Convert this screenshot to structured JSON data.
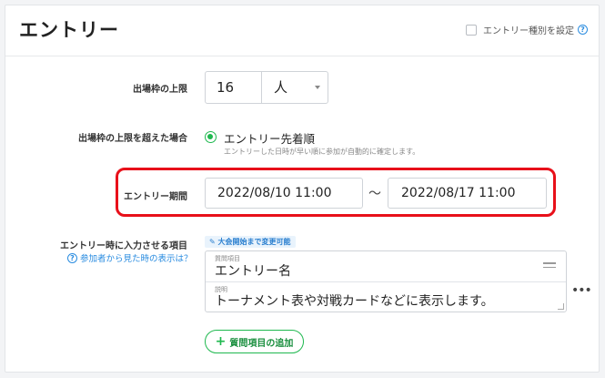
{
  "header": {
    "title": "エントリー",
    "entry_type_label": "エントリー種別を設定",
    "entry_type_checked": false
  },
  "capacity": {
    "label": "出場枠の上限",
    "value": "16",
    "unit": "人"
  },
  "overflow": {
    "label": "出場枠の上限を超えた場合",
    "option_label": "エントリー先着順",
    "option_desc": "エントリーした日時が早い順に参加が自動的に確定します。"
  },
  "entry_period": {
    "label": "エントリー期間",
    "start": "2022/08/10 11:00",
    "separator": "〜",
    "end": "2022/08/17 11:00",
    "highlight_color": "#e8101a"
  },
  "items": {
    "label": "エントリー時に入力させる項目",
    "help_link": "参加者から見た時の表示は？",
    "edit_badge": "大会開始まで変更可能",
    "question_label": "質問項目",
    "question_value": "エントリー名",
    "desc_label": "説明",
    "desc_value": "トーナメント表や対戦カードなどに表示します。",
    "add_button": "質問項目の追加"
  },
  "colors": {
    "accent_green": "#1fb84f",
    "link_blue": "#2a8ce0"
  }
}
